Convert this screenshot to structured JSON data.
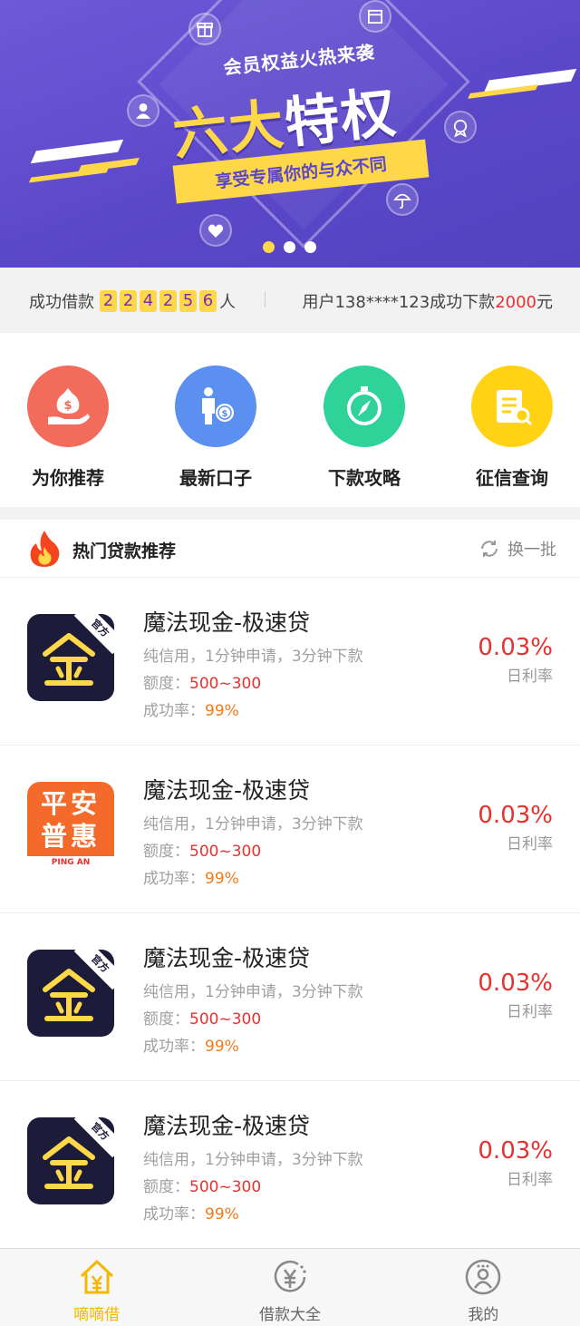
{
  "banner": {
    "subtitle": "会员权益火热来袭",
    "headline_yellow": "六大",
    "headline_white": "特权",
    "ribbon": "享受专属你的与众不同",
    "slides": 3,
    "active_slide": 1
  },
  "stats": {
    "prefix": "成功借款",
    "digits": [
      "2",
      "2",
      "4",
      "2",
      "5",
      "6"
    ],
    "suffix": "人",
    "notice_prefix": "用户138****123成功下款",
    "notice_amount": "2000",
    "notice_unit": "元"
  },
  "quick_nav": [
    {
      "label": "为你推荐",
      "icon": "money-bag-hand-icon",
      "color": "#f26b5b"
    },
    {
      "label": "最新口子",
      "icon": "businessman-coin-icon",
      "color": "#5b8ff0"
    },
    {
      "label": "下款攻略",
      "icon": "compass-icon",
      "color": "#2fd39a"
    },
    {
      "label": "征信查询",
      "icon": "report-search-icon",
      "color": "#ffd313"
    }
  ],
  "section": {
    "title": "热门贷款推荐",
    "refresh_label": "换一批"
  },
  "loans": [
    {
      "name": "魔法现金-极速贷",
      "desc": "纯信用，1分钟申请，3分钟下款",
      "quota_label": "额度：",
      "quota": "500~300",
      "success_label": "成功率：",
      "success": "99%",
      "rate": "0.03%",
      "rate_label": "日利率",
      "logo": "jin",
      "logo_tag": "官方",
      "logo_char": "金"
    },
    {
      "name": "魔法现金-极速贷",
      "desc": "纯信用，1分钟申请，3分钟下款",
      "quota_label": "额度：",
      "quota": "500~300",
      "success_label": "成功率：",
      "success": "99%",
      "rate": "0.03%",
      "rate_label": "日利率",
      "logo": "pingan",
      "logo_line1": "平安",
      "logo_line2": "普惠",
      "logo_sub": "PING AN"
    },
    {
      "name": "魔法现金-极速贷",
      "desc": "纯信用，1分钟申请，3分钟下款",
      "quota_label": "额度：",
      "quota": "500~300",
      "success_label": "成功率：",
      "success": "99%",
      "rate": "0.03%",
      "rate_label": "日利率",
      "logo": "jin",
      "logo_tag": "官方",
      "logo_char": "金"
    },
    {
      "name": "魔法现金-极速贷",
      "desc": "纯信用，1分钟申请，3分钟下款",
      "quota_label": "额度：",
      "quota": "500~300",
      "success_label": "成功率：",
      "success": "99%",
      "rate": "0.03%",
      "rate_label": "日利率",
      "logo": "jin",
      "logo_tag": "官方",
      "logo_char": "金"
    }
  ],
  "tabs": [
    {
      "label": "嘀嘀借",
      "icon": "home-yen-icon",
      "active": true
    },
    {
      "label": "借款大全",
      "icon": "yen-circle-icon",
      "active": false
    },
    {
      "label": "我的",
      "icon": "user-icon",
      "active": false
    }
  ],
  "colors": {
    "accent": "#ffd84a",
    "red": "#e8302f",
    "orange": "#f07a1a",
    "banner_bg": "#5b47c9"
  }
}
